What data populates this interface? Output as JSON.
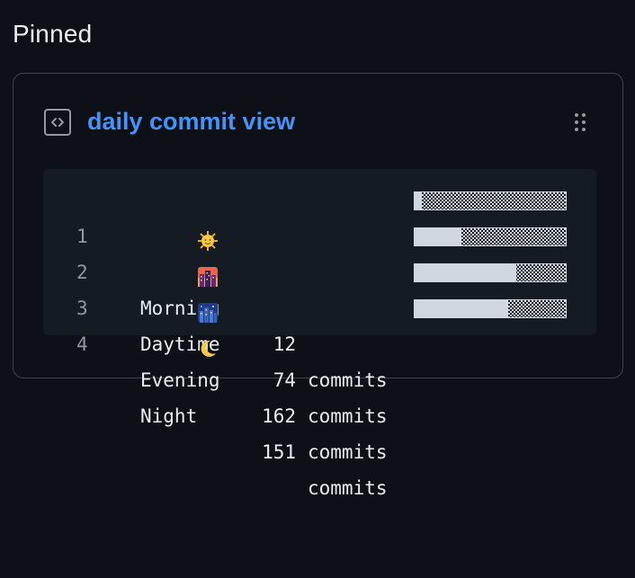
{
  "section": {
    "heading": "Pinned"
  },
  "gist": {
    "title": "daily commit view",
    "icon": "code-square-icon",
    "drag_icon": "grabber-icon",
    "rows": [
      {
        "line": "1",
        "emoji": "sun-with-face-icon",
        "label": "Morning",
        "count": "12",
        "unit": "commits",
        "fraction": 0.05
      },
      {
        "line": "2",
        "emoji": "cityscape-at-dusk-icon",
        "label": "Daytime",
        "count": "74",
        "unit": "commits",
        "fraction": 0.31
      },
      {
        "line": "3",
        "emoji": "night-with-stars-icon",
        "label": "Evening",
        "count": "162",
        "unit": "commits",
        "fraction": 0.67
      },
      {
        "line": "4",
        "emoji": "crescent-moon-icon",
        "label": "Night",
        "count": "151",
        "unit": "commits",
        "fraction": 0.62
      }
    ]
  },
  "colors": {
    "background": "#0d1117",
    "link": "#4493f8",
    "code_background": "#151b23",
    "bar": "#d1d7e0",
    "muted": "#9198a1"
  }
}
